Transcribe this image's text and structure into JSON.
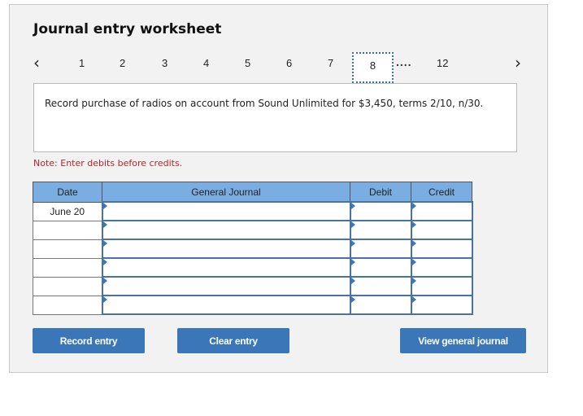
{
  "header": {
    "title": "Journal entry worksheet"
  },
  "pager": {
    "prev_icon": "chevron-left-icon",
    "next_icon": "chevron-right-icon",
    "pages": [
      "1",
      "2",
      "3",
      "4",
      "5",
      "6",
      "7"
    ],
    "active": "8",
    "ellipsis": "....",
    "last": "12"
  },
  "question": {
    "text": "Record purchase of radios on account from Sound Unlimited for $3,450, terms 2/10, n/30."
  },
  "note": "Note: Enter debits before credits.",
  "table": {
    "columns": [
      "Date",
      "General Journal",
      "Debit",
      "Credit"
    ],
    "rows": [
      {
        "date": "June 20",
        "account": "",
        "debit": "",
        "credit": ""
      },
      {
        "date": "",
        "account": "",
        "debit": "",
        "credit": ""
      },
      {
        "date": "",
        "account": "",
        "debit": "",
        "credit": ""
      },
      {
        "date": "",
        "account": "",
        "debit": "",
        "credit": ""
      },
      {
        "date": "",
        "account": "",
        "debit": "",
        "credit": ""
      },
      {
        "date": "",
        "account": "",
        "debit": "",
        "credit": ""
      }
    ]
  },
  "buttons": {
    "record": "Record entry",
    "clear": "Clear entry",
    "view": "View general journal"
  },
  "colors": {
    "header_bg": "#7aaee3",
    "button_bg": "#3a76b8",
    "note": "#b3262c"
  }
}
